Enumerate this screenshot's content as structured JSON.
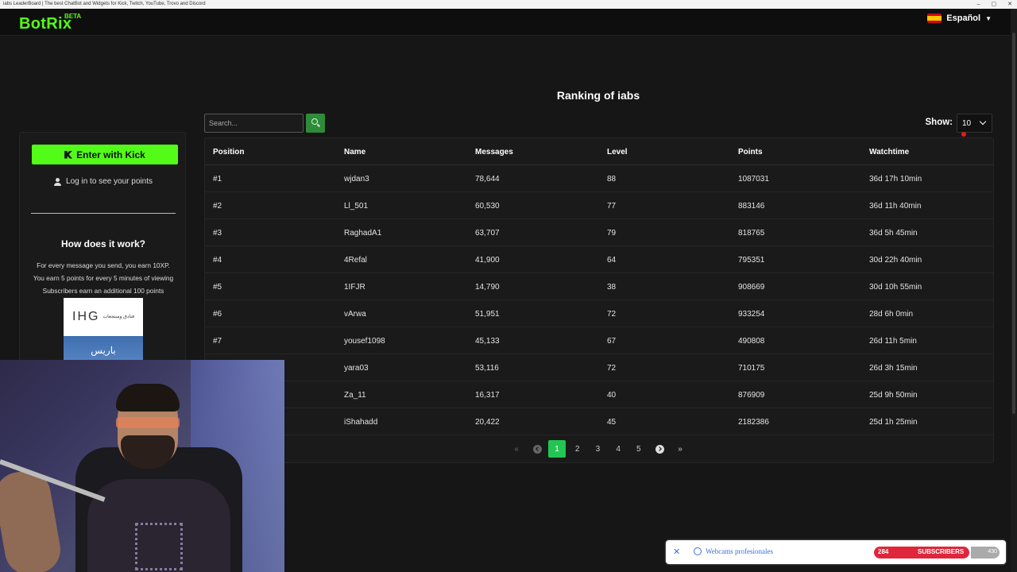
{
  "window": {
    "title": "iabs LeaderBoard | The best ChatBot and Widgets for Kick, Twitch, YouTube, Trovo and Discord"
  },
  "brand": {
    "name": "BotRix",
    "badge": "BETA",
    "color": "#53fc18"
  },
  "language": {
    "label": "Español",
    "icon": "spain-flag-icon"
  },
  "page": {
    "title": "Ranking of iabs"
  },
  "search": {
    "placeholder": "Search..."
  },
  "show": {
    "label": "Show:",
    "value": "10"
  },
  "sidebar": {
    "kick_button": "Enter with Kick",
    "login_text": "Log in to see your points",
    "how_title": "How does it work?",
    "how_lines": [
      "For every message you send, you earn 10XP.",
      "You earn 5 points for every 5 minutes of viewing",
      "Subscribers earn an additional 100 points"
    ],
    "ad": {
      "brand": "IHG",
      "sub": "فنادق ومنتجعات",
      "city": "باريس"
    }
  },
  "table": {
    "columns": [
      "Position",
      "Name",
      "Messages",
      "Level",
      "Points",
      "Watchtime"
    ],
    "rows": [
      [
        "#1",
        "wjdan3",
        "78,644",
        "88",
        "1087031",
        "36d 17h 10min"
      ],
      [
        "#2",
        "Ll_501",
        "60,530",
        "77",
        "883146",
        "36d 11h 40min"
      ],
      [
        "#3",
        "RaghadA1",
        "63,707",
        "79",
        "818765",
        "36d 5h 45min"
      ],
      [
        "#4",
        "4Refal",
        "41,900",
        "64",
        "795351",
        "30d 22h 40min"
      ],
      [
        "#5",
        "1IFJR",
        "14,790",
        "38",
        "908669",
        "30d 10h 55min"
      ],
      [
        "#6",
        "vArwa",
        "51,951",
        "72",
        "933254",
        "28d 6h 0min"
      ],
      [
        "#7",
        "yousef1098",
        "45,133",
        "67",
        "490808",
        "26d 11h 5min"
      ],
      [
        "",
        "yara03",
        "53,116",
        "72",
        "710175",
        "26d 3h 15min"
      ],
      [
        "",
        "Za_11",
        "16,317",
        "40",
        "876909",
        "25d 9h 50min"
      ],
      [
        "",
        "iShahadd",
        "20,422",
        "45",
        "2182386",
        "25d 1h 25min"
      ]
    ]
  },
  "pagination": {
    "pages": [
      "1",
      "2",
      "3",
      "4",
      "5"
    ],
    "active": "1"
  },
  "bottom_ad": {
    "close": "✕",
    "text": "Webcams profesionales"
  },
  "sub_goal": {
    "count": "284",
    "label": "SUBSCRIBERS",
    "goal": "430"
  }
}
